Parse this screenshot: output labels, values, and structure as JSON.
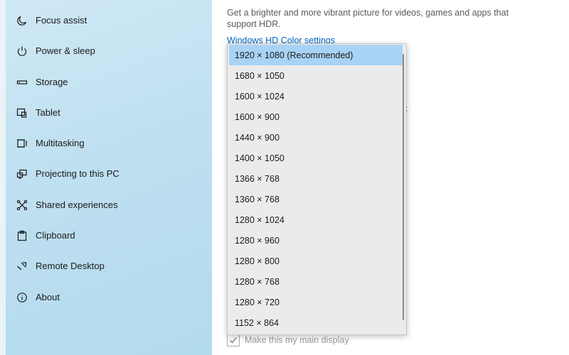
{
  "sidebar": {
    "items": [
      {
        "label": "Focus assist",
        "icon": "moon-icon"
      },
      {
        "label": "Power & sleep",
        "icon": "power-icon"
      },
      {
        "label": "Storage",
        "icon": "storage-icon"
      },
      {
        "label": "Tablet",
        "icon": "tablet-icon"
      },
      {
        "label": "Multitasking",
        "icon": "multitasking-icon"
      },
      {
        "label": "Projecting to this PC",
        "icon": "projecting-icon"
      },
      {
        "label": "Shared experiences",
        "icon": "shared-experiences-icon"
      },
      {
        "label": "Clipboard",
        "icon": "clipboard-icon"
      },
      {
        "label": "Remote Desktop",
        "icon": "remote-desktop-icon"
      },
      {
        "label": "About",
        "icon": "info-icon"
      }
    ]
  },
  "content": {
    "hdr_description": "Get a brighter and more vibrant picture for videos, games and apps that support HDR.",
    "hdr_link": "Windows HD Color settings",
    "main_display_label": "Make this my main display",
    "main_display_checked": true
  },
  "resolution_dropdown": {
    "selected_index": 0,
    "options": [
      "1920 × 1080 (Recommended)",
      "1680 × 1050",
      "1600 × 1024",
      "1600 × 900",
      "1440 × 900",
      "1400 × 1050",
      "1366 × 768",
      "1360 × 768",
      "1280 × 1024",
      "1280 × 960",
      "1280 × 800",
      "1280 × 768",
      "1280 × 720",
      "1152 × 864"
    ]
  },
  "colors": {
    "accent_link": "#0067c0",
    "selected_option": "#a9d3f5"
  }
}
